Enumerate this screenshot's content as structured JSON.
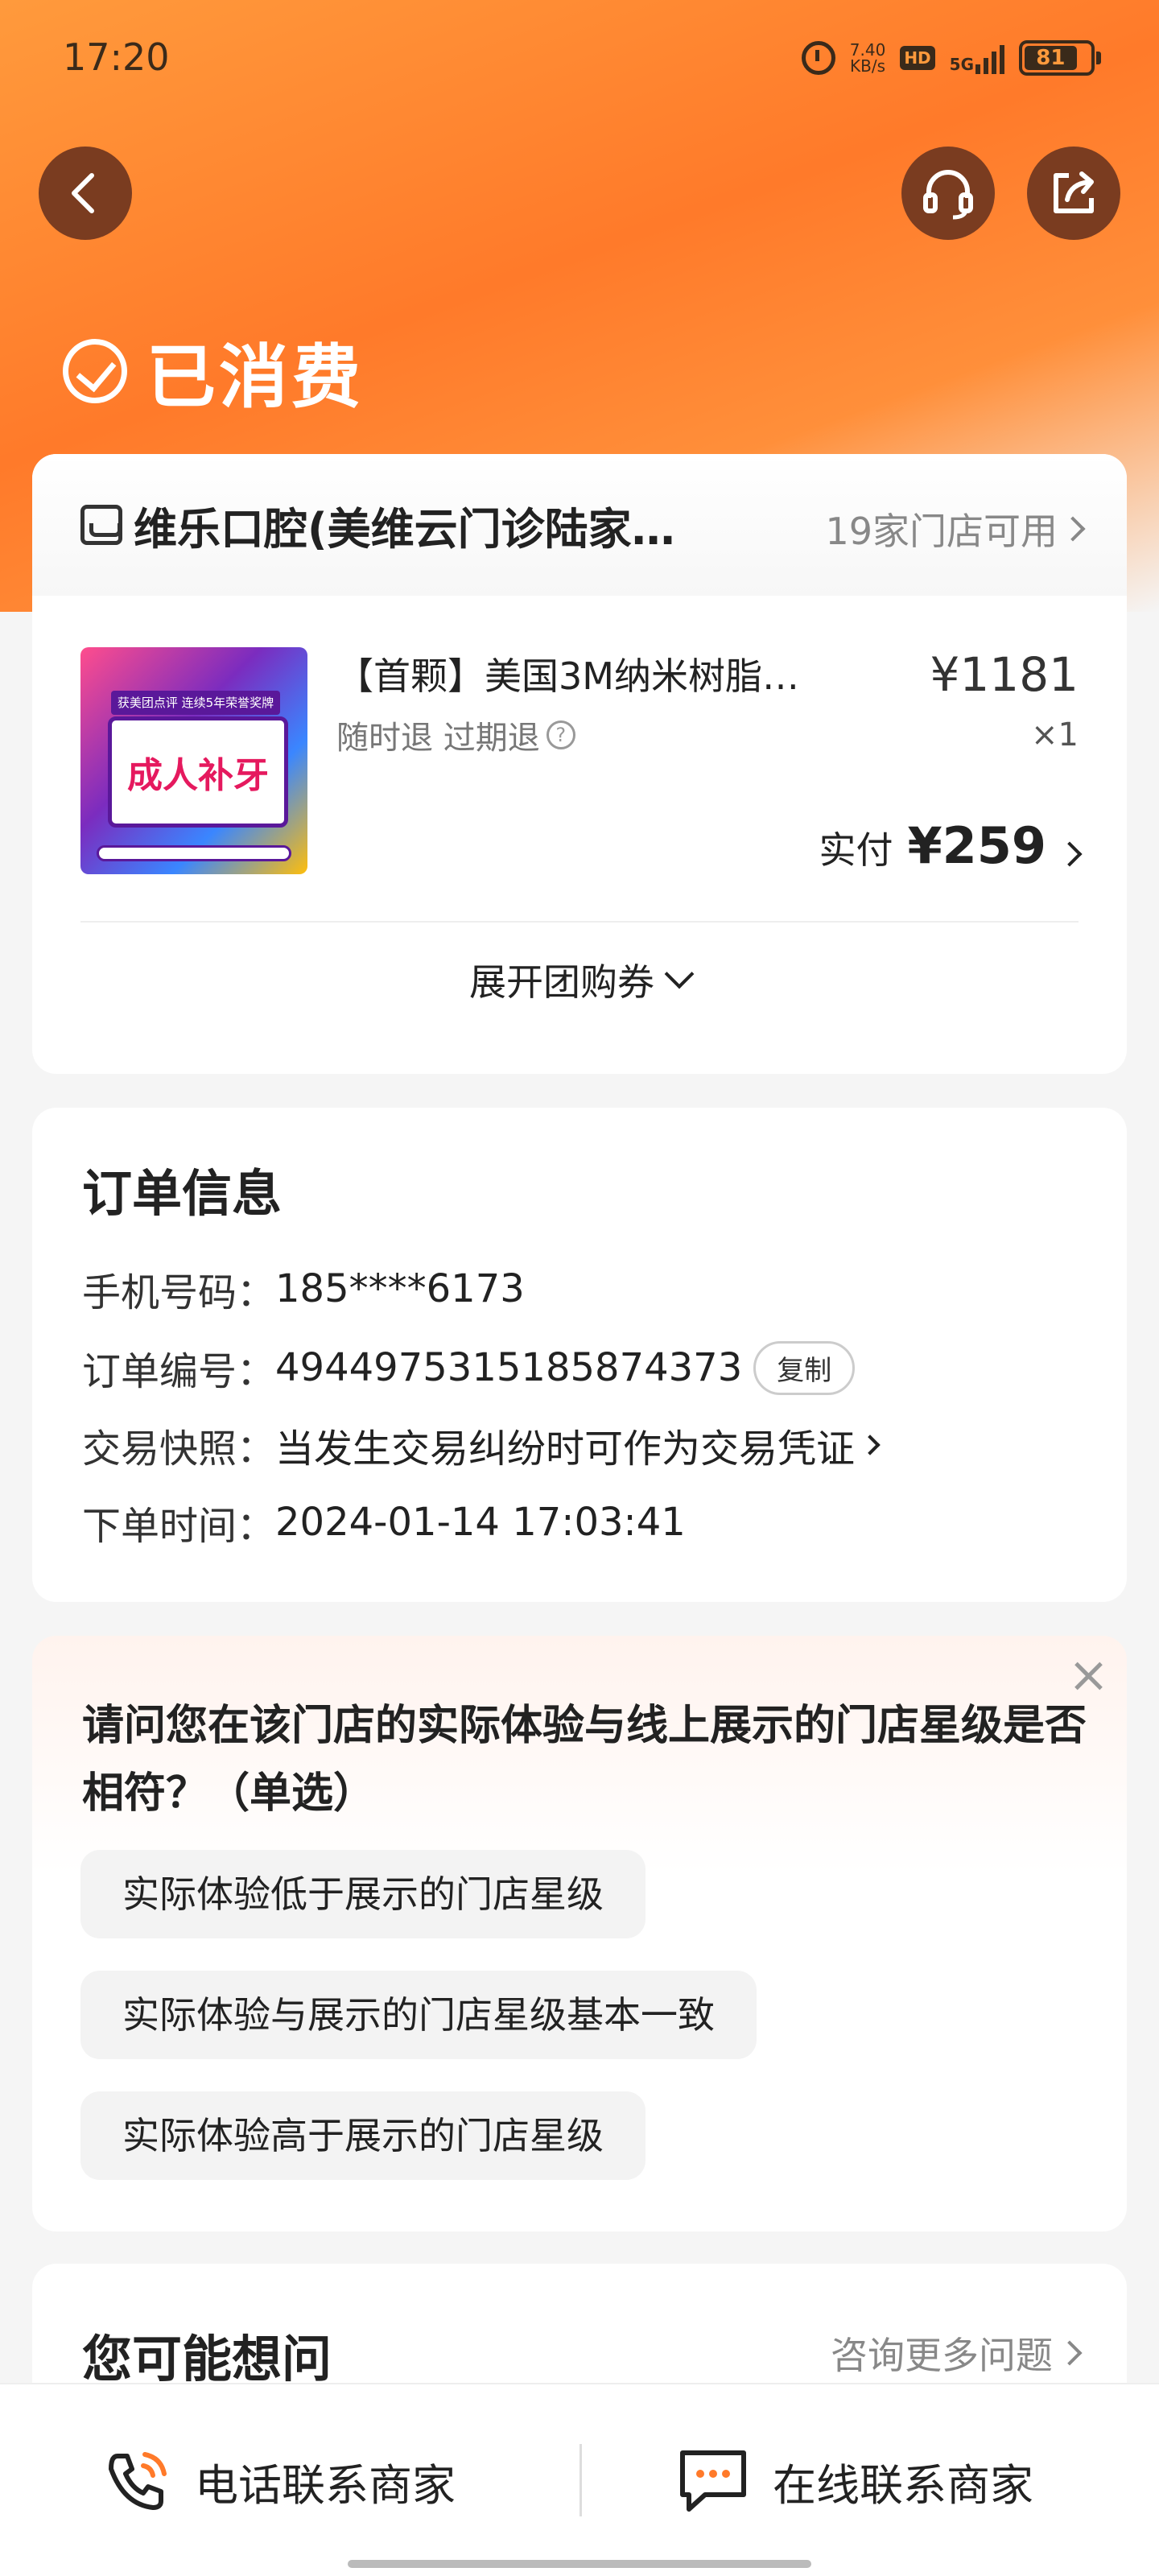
{
  "status_bar": {
    "time": "17:20",
    "net_speed_value": "7.40",
    "net_speed_unit": "KB/s",
    "hd_label": "HD",
    "network": "5G",
    "battery": "81"
  },
  "icons": {
    "back": "back-arrow-icon",
    "customer_service": "headset-icon",
    "share": "share-icon",
    "status": "check-circle-icon",
    "store": "store-icon",
    "phone": "phone-icon",
    "chat": "chat-icon",
    "close": "close-icon"
  },
  "colors": {
    "accent": "#ff7a2a",
    "brand_dark": "#7a3c20"
  },
  "order_status": "已消费",
  "store": {
    "name": "维乐口腔(美维云门诊陆家…",
    "available": "19家门店可用"
  },
  "product": {
    "thumbnail_banner": "获美团点评 连续5年荣誉奖牌",
    "thumbnail_text": "成人补牙",
    "title": "【首颗】美国3M纳米树脂…",
    "tags": "随时退 过期退",
    "help_mark": "?",
    "price": "¥1181",
    "quantity": "×1",
    "paid_label": "实付",
    "paid_amount": "¥259",
    "expand_label": "展开团购券"
  },
  "order_info": {
    "title": "订单信息",
    "rows": [
      {
        "label": "手机号码：",
        "value": "185****6173"
      },
      {
        "label": "订单编号：",
        "value": "4944975315185874373"
      },
      {
        "label": "交易快照：",
        "value": "当发生交易纠纷时可作为交易凭证"
      },
      {
        "label": "下单时间：",
        "value": "2024-01-14 17:03:41"
      }
    ],
    "copy_label": "复制"
  },
  "survey": {
    "question": "请问您在该门店的实际体验与线上展示的门店星级是否相符？（单选）",
    "options": [
      "实际体验低于展示的门店星级",
      "实际体验与展示的门店星级基本一致",
      "实际体验高于展示的门店星级"
    ]
  },
  "faq": {
    "title": "您可能想问",
    "more": "咨询更多问题"
  },
  "bottom_bar": {
    "phone_label": "电话联系商家",
    "chat_label": "在线联系商家"
  }
}
